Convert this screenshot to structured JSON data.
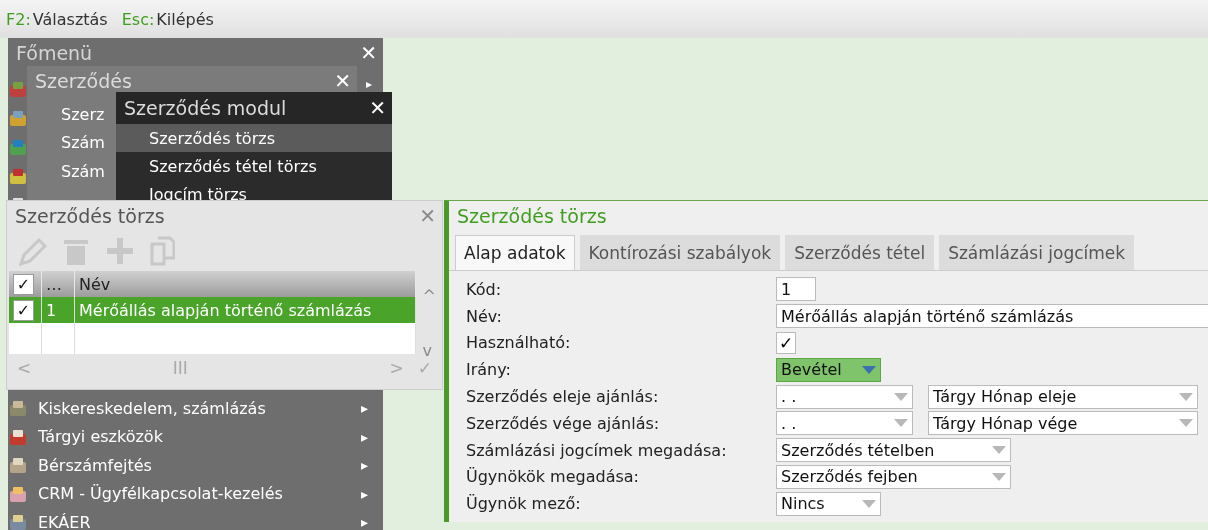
{
  "hotkeys": [
    {
      "key": "F2:",
      "label": "Választás"
    },
    {
      "key": "Esc:",
      "label": "Kilépés"
    }
  ],
  "main_menu": {
    "title": "Főmenü",
    "close": "✕",
    "items": [
      {
        "label": "Kiskereskedelem, számlázás",
        "arrow": "▸"
      },
      {
        "label": "Tárgyi eszközök",
        "arrow": "▸"
      },
      {
        "label": "Bérszámfejtés",
        "arrow": "▸"
      },
      {
        "label": "CRM - Ügyfélkapcsolat-kezelés",
        "arrow": "▸"
      },
      {
        "label": "EKÁER",
        "arrow": "▸"
      }
    ]
  },
  "submenu": {
    "title": "Szerződés",
    "close": "✕",
    "arrow": "▸",
    "items": [
      "Szerz",
      "Szám",
      "Szám"
    ]
  },
  "module_menu": {
    "title": "Szerződés modul",
    "close": "✕",
    "items": [
      {
        "label": "Szerződés törzs",
        "selected": true
      },
      {
        "label": "Szerződés tétel törzs",
        "selected": false
      },
      {
        "label": "Jogcím törzs",
        "selected": false
      }
    ]
  },
  "list_window": {
    "title": "Szerződés törzs",
    "close": "✕",
    "check_mark": "✓",
    "columns": [
      "…",
      "Név"
    ],
    "header_checked": true,
    "rows": [
      {
        "checked": true,
        "selected": true,
        "cells": [
          "1",
          "Mérőállás alapján történő számlázás"
        ]
      }
    ],
    "scroll": {
      "left": "<",
      "thumb": "III",
      "right": ">",
      "ok": "✓",
      "up": "^",
      "down": "v"
    }
  },
  "detail": {
    "title": "Szerződés törzs",
    "tabs": [
      {
        "label": "Alap adatok",
        "selected": true
      },
      {
        "label": "Kontírozási szabályok",
        "selected": false
      },
      {
        "label": "Szerződés tétel",
        "selected": false
      },
      {
        "label": "Számlázási jogcímek",
        "selected": false
      }
    ],
    "fields": [
      {
        "label": "Kód:",
        "kind": "text",
        "value": "1"
      },
      {
        "label": "Név:",
        "kind": "text",
        "value": "Mérőállás alapján történő számlázás"
      },
      {
        "label": "Használható:",
        "kind": "checkbox",
        "checked": true,
        "mark": "✓"
      },
      {
        "label": "Irány:",
        "kind": "select",
        "value": "Bevétel",
        "highlight": true
      },
      {
        "label": "Szerződés eleje ajánlás:",
        "kind": "pair",
        "value": ".  .",
        "value2": "Tárgy Hónap eleje"
      },
      {
        "label": "Szerződés vége ajánlás:",
        "kind": "pair",
        "value": ".  .",
        "value2": "Tárgy Hónap vége"
      },
      {
        "label": "Számlázási jogcímek megadása:",
        "kind": "select",
        "value": "Szerződés tételben",
        "highlight": false
      },
      {
        "label": "Ügynökök megadása:",
        "kind": "select",
        "value": "Szerződés fejben",
        "highlight": false
      },
      {
        "label": "Ügynök mező:",
        "kind": "select",
        "value": "Nincs",
        "highlight": false
      }
    ]
  }
}
